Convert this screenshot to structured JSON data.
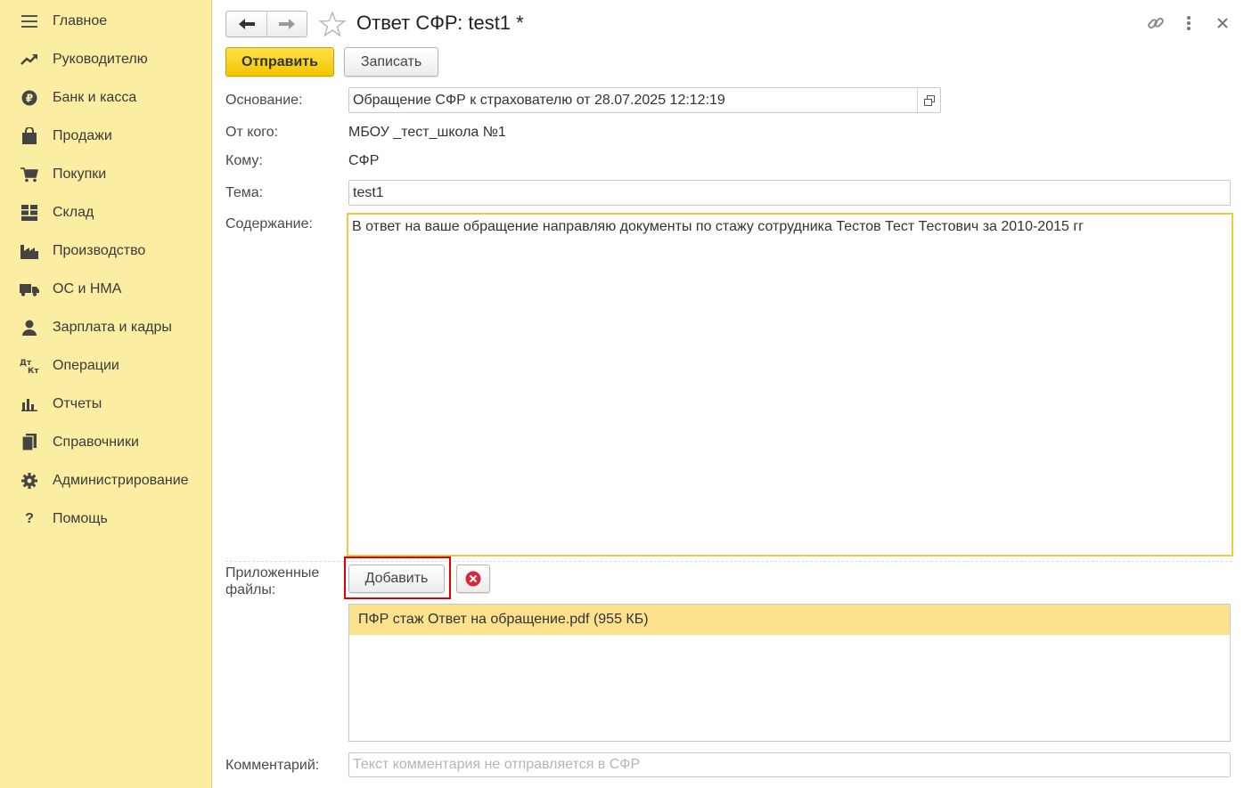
{
  "sidebar": {
    "items": [
      {
        "label": "Главное",
        "icon": "menu-icon"
      },
      {
        "label": "Руководителю",
        "icon": "trend-icon"
      },
      {
        "label": "Банк и касса",
        "icon": "ruble-icon"
      },
      {
        "label": "Продажи",
        "icon": "shopping-bag-icon"
      },
      {
        "label": "Покупки",
        "icon": "cart-icon"
      },
      {
        "label": "Склад",
        "icon": "warehouse-icon"
      },
      {
        "label": "Производство",
        "icon": "factory-icon"
      },
      {
        "label": "ОС и НМА",
        "icon": "truck-icon"
      },
      {
        "label": "Зарплата и кадры",
        "icon": "person-icon"
      },
      {
        "label": "Операции",
        "icon": "dt-kt-icon"
      },
      {
        "label": "Отчеты",
        "icon": "bar-chart-icon"
      },
      {
        "label": "Справочники",
        "icon": "books-icon"
      },
      {
        "label": "Администрирование",
        "icon": "gear-icon"
      },
      {
        "label": "Помощь",
        "icon": "question-icon"
      }
    ]
  },
  "header": {
    "title": "Ответ СФР: test1 *",
    "send_label": "Отправить",
    "save_label": "Записать"
  },
  "form": {
    "basis_label": "Основание:",
    "basis_value": "Обращение СФР к страхователю от 28.07.2025 12:12:19",
    "from_label": "От кого:",
    "from_value": "МБОУ _тест_школа №1",
    "to_label": "Кому:",
    "to_value": "СФР",
    "subject_label": "Тема:",
    "subject_value": "test1",
    "content_label": "Содержание:",
    "content_value": "В ответ на ваше обращение направляю документы по стажу сотрудника Тестов Тест Тестович за 2010-2015 гг",
    "attachments_label_line1": "Приложенные",
    "attachments_label_line2": "файлы:",
    "add_label": "Добавить",
    "files": [
      {
        "name": "ПФР стаж Ответ на обращение.pdf (955 КБ)"
      }
    ],
    "comment_label": "Комментарий:",
    "comment_placeholder": "Текст комментария не отправляется в СФР"
  },
  "colors": {
    "sidebar_bg": "#fbeda1",
    "primary_button": "#f2c500",
    "highlight_border": "#e00000",
    "selected_row": "#fde28d"
  }
}
